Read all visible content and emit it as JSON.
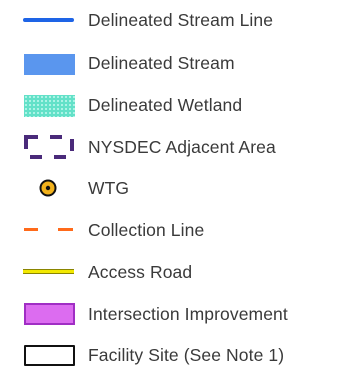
{
  "legend": {
    "items": [
      {
        "label": "Delineated Stream Line",
        "symbol": "line",
        "color": "#1e64e6"
      },
      {
        "label": "Delineated Stream",
        "symbol": "fill",
        "color": "#5a96ee"
      },
      {
        "label": "Delineated Wetland",
        "symbol": "pattern-fill",
        "color": "#63e1c8",
        "pattern_color": "#9cf0df"
      },
      {
        "label": "NYSDEC Adjacent Area",
        "symbol": "dashed-box",
        "color": "#4a2a7a"
      },
      {
        "label": "WTG",
        "symbol": "point-icon",
        "color": "#f2b21c",
        "outline_color": "#111111"
      },
      {
        "label": "Collection Line",
        "symbol": "dashed-line",
        "color": "#ff6a1a"
      },
      {
        "label": "Access Road",
        "symbol": "double-line",
        "color": "#f2e800",
        "outline_color": "#8a8500"
      },
      {
        "label": "Intersection Improvement",
        "symbol": "outlined-fill",
        "color": "#dc6cf0",
        "outline_color": "#a02ec4"
      },
      {
        "label": "Facility Site (See Note 1)",
        "symbol": "outline-box",
        "color": "#111111"
      }
    ]
  }
}
